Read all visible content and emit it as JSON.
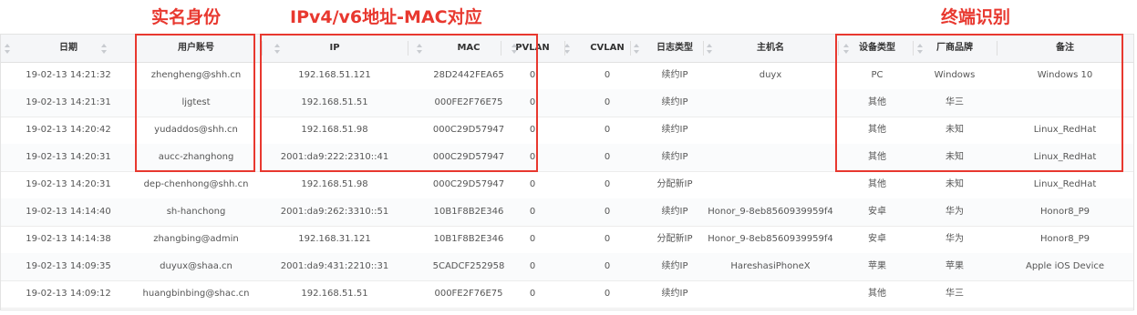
{
  "annotations": {
    "identity": "实名身份",
    "address": "IPv4/v6地址-MAC对应",
    "terminal": "终端识别"
  },
  "table": {
    "columns": [
      "日期",
      "用户账号",
      "IP",
      "MAC",
      "PVLAN",
      "CVLAN",
      "日志类型",
      "主机名",
      "设备类型",
      "厂商品牌",
      "备注"
    ],
    "rows": [
      [
        "19-02-13 14:21:32",
        "zhengheng@shh.cn",
        "192.168.51.121",
        "28D2442FEA65",
        "0",
        "0",
        "续约IP",
        "duyx",
        "PC",
        "Windows",
        "Windows 10"
      ],
      [
        "19-02-13 14:21:31",
        "ljgtest",
        "192.168.51.51",
        "000FE2F76E75",
        "0",
        "0",
        "续约IP",
        "",
        "其他",
        "华三",
        ""
      ],
      [
        "19-02-13 14:20:42",
        "yudaddos@shh.cn",
        "192.168.51.98",
        "000C29D57947",
        "0",
        "0",
        "续约IP",
        "",
        "其他",
        "未知",
        "Linux_RedHat"
      ],
      [
        "19-02-13 14:20:31",
        "aucc-zhanghong",
        "2001:da9:222:2310::41",
        "000C29D57947",
        "0",
        "0",
        "续约IP",
        "",
        "其他",
        "未知",
        "Linux_RedHat"
      ],
      [
        "19-02-13 14:20:31",
        "dep-chenhong@shh.cn",
        "192.168.51.98",
        "000C29D57947",
        "0",
        "0",
        "分配新IP",
        "",
        "其他",
        "未知",
        "Linux_RedHat"
      ],
      [
        "19-02-13 14:14:40",
        "sh-hanchong",
        "2001:da9:262:3310::51",
        "10B1F8B2E346",
        "0",
        "0",
        "续约IP",
        "Honor_9-8eb8560939959f4",
        "安卓",
        "华为",
        "Honor8_P9"
      ],
      [
        "19-02-13 14:14:38",
        "zhangbing@admin",
        "192.168.31.121",
        "10B1F8B2E346",
        "0",
        "0",
        "分配新IP",
        "Honor_9-8eb8560939959f4",
        "安卓",
        "华为",
        "Honor8_P9"
      ],
      [
        "19-02-13 14:09:35",
        "duyux@shaa.cn",
        "2001:da9:431:2210::31",
        "5CADCF252958",
        "0",
        "0",
        "续约IP",
        "HareshasiPhoneX",
        "苹果",
        "苹果",
        "Apple iOS Device"
      ],
      [
        "19-02-13 14:09:12",
        "huangbinbing@shac.cn",
        "192.168.51.51",
        "000FE2F76E75",
        "0",
        "0",
        "续约IP",
        "",
        "其他",
        "华三",
        ""
      ]
    ]
  },
  "colors": {
    "annotation": "#e8382f",
    "header_bg": "#f5f6f8"
  },
  "icons": {
    "sort": "sort-icon"
  }
}
